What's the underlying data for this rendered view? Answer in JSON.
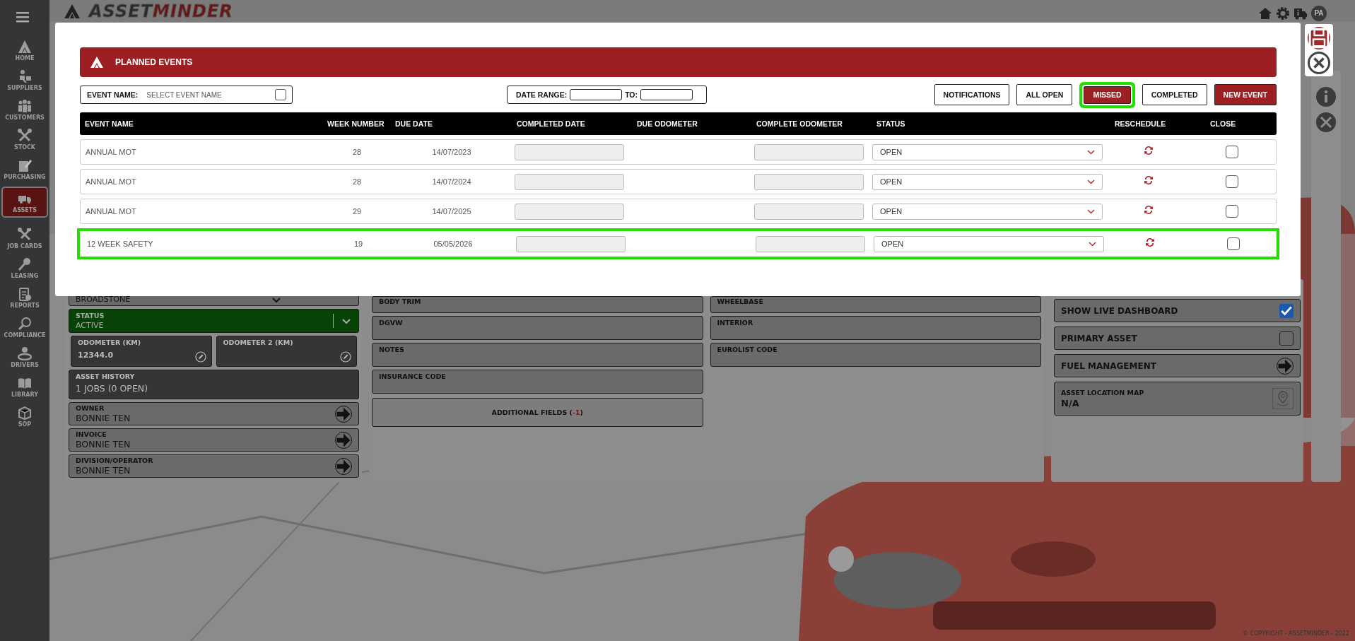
{
  "sidebar": {
    "items": [
      {
        "label": "HOME",
        "selected": false
      },
      {
        "label": "SUPPLIERS",
        "selected": false
      },
      {
        "label": "CUSTOMERS",
        "selected": false
      },
      {
        "label": "STOCK",
        "selected": false
      },
      {
        "label": "PURCHASING",
        "selected": false
      },
      {
        "label": "ASSETS",
        "selected": true
      },
      {
        "label": "JOB CARDS",
        "selected": false
      },
      {
        "label": "LEASING",
        "selected": false
      },
      {
        "label": "REPORTS",
        "selected": false
      },
      {
        "label": "COMPLIANCE",
        "selected": false
      },
      {
        "label": "DRIVERS",
        "selected": false
      },
      {
        "label": "LIBRARY",
        "selected": false
      },
      {
        "label": "SOP",
        "selected": false
      }
    ]
  },
  "header": {
    "logo": {
      "first": "ASSET",
      "second": "MINDER"
    },
    "avatar": "PA"
  },
  "left_panel": [
    {
      "kind": "select",
      "value": "BROADSTONE"
    },
    {
      "kind": "status",
      "label": "STATUS",
      "value": "ACTIVE"
    },
    {
      "kind": "pair",
      "fields": [
        {
          "label": "ODOMETER (KM)",
          "value": "12344.0"
        },
        {
          "label": "ODOMETER 2 (KM)"
        }
      ]
    },
    {
      "kind": "history",
      "label": "ASSET HISTORY",
      "value": "1 JOBS (0 OPEN)"
    },
    {
      "kind": "link",
      "label": "OWNER",
      "value": "BONNIE TEN"
    },
    {
      "kind": "link",
      "label": "INVOICE",
      "value": "BONNIE TEN"
    },
    {
      "kind": "link",
      "label": "DIVISION/OPERATOR",
      "value": "BONNIE TEN"
    }
  ],
  "middle_panel": {
    "column_1": [
      "BODY TRIM",
      "DGVW",
      "NOTES",
      "INSURANCE CODE"
    ],
    "column_2": [
      "WHEELBASE",
      "INTERIOR",
      "EUROLIST CODE"
    ],
    "additional_fields": {
      "prefix": "ADDITIONAL FIELDS (",
      "count": "-1",
      "suffix": ")"
    }
  },
  "right_panel": [
    {
      "kind": "checkbox",
      "label": "SHOW LIVE DASHBOARD",
      "checked": true
    },
    {
      "kind": "checkbox",
      "label": "PRIMARY ASSET",
      "checked": false
    },
    {
      "kind": "link",
      "label": "FUEL MANAGEMENT"
    },
    {
      "kind": "map",
      "label": "ASSET LOCATION MAP",
      "value": "N/A"
    }
  ],
  "modal": {
    "title": "PLANNED EVENTS",
    "event_filter": {
      "label": "EVENT NAME:",
      "placeholder": "SELECT EVENT NAME",
      "checked": false
    },
    "date_range": {
      "label": "DATE RANGE:",
      "to_label": "TO:"
    },
    "buttons": [
      {
        "kind": "filter",
        "label": "NOTIFICATIONS",
        "selected": false,
        "highlighted": false
      },
      {
        "kind": "filter",
        "label": "ALL OPEN",
        "selected": false,
        "highlighted": false
      },
      {
        "kind": "filter",
        "label": "MISSED",
        "selected": true,
        "highlighted": true
      },
      {
        "kind": "filter",
        "label": "COMPLETED",
        "selected": false,
        "highlighted": false
      },
      {
        "kind": "primary",
        "label": "NEW EVENT",
        "highlighted": false
      }
    ],
    "table": {
      "columns": [
        "EVENT NAME",
        "WEEK NUMBER",
        "DUE DATE",
        "COMPLETED DATE",
        "DUE ODOMETER",
        "COMPLETE ODOMETER",
        "STATUS",
        "RESCHEDULE",
        "CLOSE"
      ],
      "rows": [
        {
          "event_name": "ANNUAL MOT",
          "week_number": "28",
          "due_date": "14/07/2023",
          "status": "OPEN",
          "closed": false,
          "highlighted": false
        },
        {
          "event_name": "ANNUAL MOT",
          "week_number": "28",
          "due_date": "14/07/2024",
          "status": "OPEN",
          "closed": false,
          "highlighted": false
        },
        {
          "event_name": "ANNUAL MOT",
          "week_number": "29",
          "due_date": "14/07/2025",
          "status": "OPEN",
          "closed": false,
          "highlighted": false
        },
        {
          "event_name": "12 WEEK SAFETY",
          "week_number": "19",
          "due_date": "05/05/2026",
          "status": "OPEN",
          "closed": false,
          "highlighted": true
        }
      ]
    }
  },
  "footer": {
    "copyright": "© COPYRIGHT - ASSETMINDER - 2022"
  }
}
